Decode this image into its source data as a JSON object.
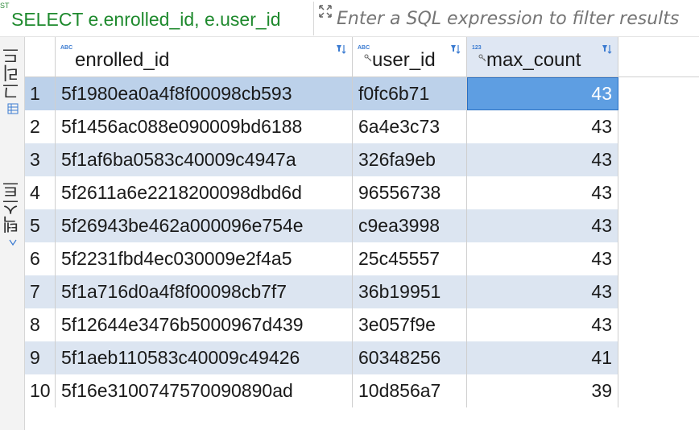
{
  "query_bar": {
    "sql_mark": "ST",
    "sql_text": "SELECT e.enrolled_id, e.user_id",
    "filter_placeholder": "Enter a SQL expression to filter results",
    "filter_icon": "filter-expand-icon"
  },
  "side_tabs": {
    "grid_label": "그리드",
    "grid_icon": "grid-icon",
    "text_label": "텍스트",
    "text_icon": "text-icon"
  },
  "columns": [
    {
      "name": "enrolled_id",
      "type_badge": "ABC",
      "icon": "sort-filter-icon"
    },
    {
      "name": "user_id",
      "type_badge": "ABC",
      "icon": "sort-filter-icon"
    },
    {
      "name": "max_count",
      "type_badge": "123",
      "icon": "sort-filter-icon"
    }
  ],
  "rows": [
    {
      "num": "1",
      "enrolled_id": "5f1980ea0a4f8f00098cb593",
      "user_id": "f0fc6b71",
      "max_count": "43"
    },
    {
      "num": "2",
      "enrolled_id": "5f1456ac088e090009bd6188",
      "user_id": "6a4e3c73",
      "max_count": "43"
    },
    {
      "num": "3",
      "enrolled_id": "5f1af6ba0583c40009c4947a",
      "user_id": "326fa9eb",
      "max_count": "43"
    },
    {
      "num": "4",
      "enrolled_id": "5f2611a6e2218200098dbd6d",
      "user_id": "96556738",
      "max_count": "43"
    },
    {
      "num": "5",
      "enrolled_id": "5f26943be462a000096e754e",
      "user_id": "c9ea3998",
      "max_count": "43"
    },
    {
      "num": "6",
      "enrolled_id": "5f2231fbd4ec030009e2f4a5",
      "user_id": "25c45557",
      "max_count": "43"
    },
    {
      "num": "7",
      "enrolled_id": "5f1a716d0a4f8f00098cb7f7",
      "user_id": "36b19951",
      "max_count": "43"
    },
    {
      "num": "8",
      "enrolled_id": "5f12644e3476b5000967d439",
      "user_id": "3e057f9e",
      "max_count": "43"
    },
    {
      "num": "9",
      "enrolled_id": "5f1aeb110583c40009c49426",
      "user_id": "60348256",
      "max_count": "41"
    },
    {
      "num": "10",
      "enrolled_id": "5f16e3100747570090890ad",
      "user_id": "10d856a7",
      "max_count": "39"
    }
  ],
  "selection": {
    "row": "1",
    "column": "max_count"
  },
  "colors": {
    "sql_green": "#1f8a2e",
    "alt_row": "#dce5f1",
    "selected_row": "#bcd1ea",
    "selected_cell": "#5e9ee2",
    "type_badge_blue": "#3b7bd1"
  }
}
